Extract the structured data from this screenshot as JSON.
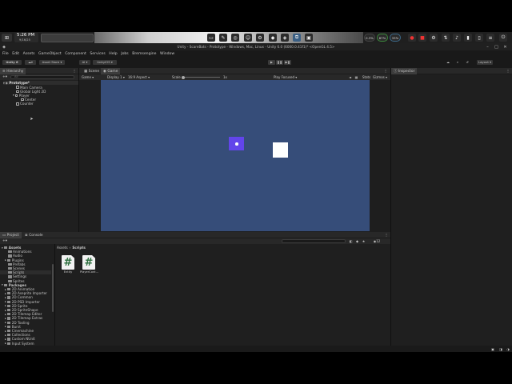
{
  "taskbar": {
    "time": "5:26 PM",
    "date": "9/16/25",
    "tray_badges": [
      "0.3%",
      "87%",
      "33%"
    ]
  },
  "editor": {
    "window_title": "Unity - ScareBats - Prototype - Windows, Mac, Linux - Unity 6.0 (6000.0.41f1)* <OpenGL 4.5>",
    "menu": [
      "File",
      "Edit",
      "Assets",
      "GameObject",
      "Component",
      "Services",
      "Help",
      "Jobs",
      "Bremsengine",
      "Window"
    ],
    "toolbar": {
      "account": "Unity 6",
      "asset_store": "Asset Store ▾",
      "ai_label": "AI ▾",
      "unity_ios": "UnityIOS ▾",
      "layout": "Layout ▾"
    },
    "hierarchy": {
      "tab": "Hierarchy",
      "search_placeholder": "All",
      "scene_name": "Prototype*",
      "items": [
        "Main Camera",
        "Global Light 2D",
        "Player",
        "Center",
        "Counter"
      ]
    },
    "scene_tabs": [
      "Scene",
      "Game"
    ],
    "game_toolbar": {
      "game_mode": "Game ▾",
      "display": "Display 1 ▾",
      "aspect": "16:9 Aspect ▾",
      "scale_label": "Scale",
      "scale_value": "1x",
      "play_focused": "Play Focused ▾",
      "stats": "Stats",
      "gizmos": "Gizmos ▾"
    },
    "inspector": {
      "tab": "Inspector"
    },
    "project": {
      "tabs": [
        "Project",
        "Console"
      ],
      "breadcrumb": [
        "Assets",
        "Scripts"
      ],
      "assets_root": "Assets",
      "asset_folders": [
        "Animations",
        "Audio",
        "Plugins",
        "Prefabs",
        "Scenes",
        "Scripts",
        "Settings",
        "Sprites"
      ],
      "packages_root": "Packages",
      "package_folders": [
        "2D Animation",
        "2D Aseprite Importer",
        "2D Common",
        "2D PSD Importer",
        "2D Sprite",
        "2D SpriteShape",
        "2D Tilemap Editor",
        "2D Tilemap Extras",
        "2D Tooling",
        "Burst",
        "Cinemachine",
        "Collections",
        "Custom NUnit",
        "Input System"
      ],
      "files": [
        {
          "name": "Entity",
          "icon": "csharp-script-icon",
          "glyph": "#"
        },
        {
          "name": "PlayerCont...",
          "icon": "csharp-script-icon",
          "glyph": "#"
        }
      ],
      "selected_folder": "Scripts",
      "zoom_slider": 0.6
    },
    "colors": {
      "game_bg": "#364d79",
      "player": "#6245ea",
      "counter": "#ffffff",
      "accent": "#3a72b0"
    }
  }
}
